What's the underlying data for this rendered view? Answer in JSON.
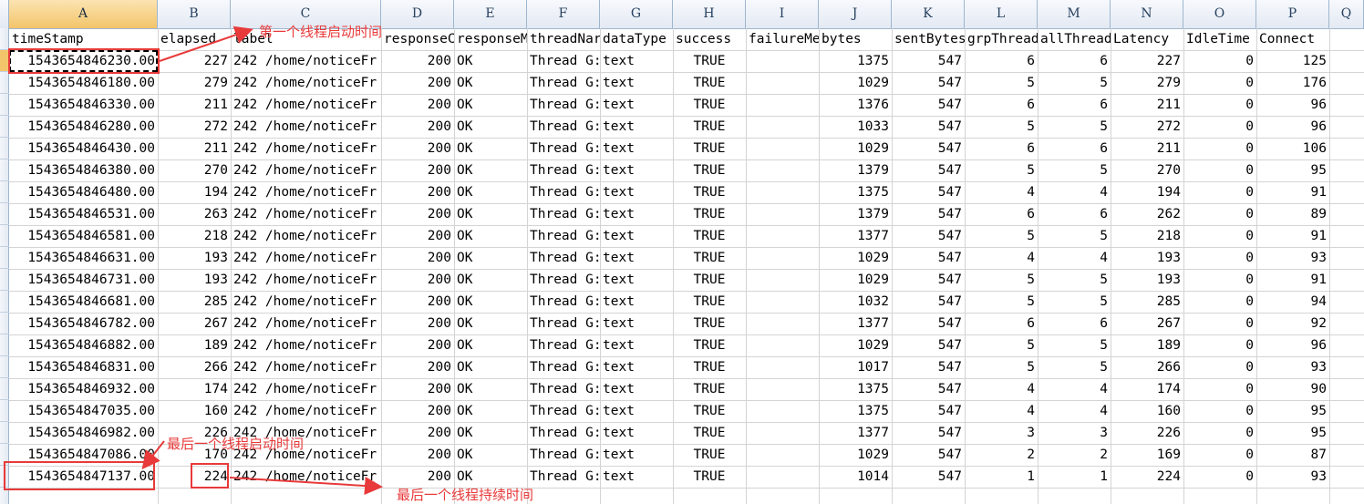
{
  "columns": [
    "A",
    "B",
    "C",
    "D",
    "E",
    "F",
    "G",
    "H",
    "I",
    "J",
    "K",
    "L",
    "M",
    "N",
    "O",
    "P",
    "Q"
  ],
  "headers": [
    "timeStamp",
    "elapsed",
    "label",
    "responseC",
    "responseM",
    "threadNar",
    "dataType",
    "success",
    "failureMe",
    "bytes",
    "sentBytes",
    "grpThread",
    "allThread",
    "Latency",
    "IdleTime",
    "Connect",
    ""
  ],
  "rows": [
    [
      "1543654846230.00",
      "227",
      "242 /home/noticeFr",
      "200",
      "OK",
      "Thread G:",
      "text",
      "TRUE",
      "",
      "1375",
      "547",
      "6",
      "6",
      "227",
      "0",
      "125"
    ],
    [
      "1543654846180.00",
      "279",
      "242 /home/noticeFr",
      "200",
      "OK",
      "Thread G:",
      "text",
      "TRUE",
      "",
      "1029",
      "547",
      "5",
      "5",
      "279",
      "0",
      "176"
    ],
    [
      "1543654846330.00",
      "211",
      "242 /home/noticeFr",
      "200",
      "OK",
      "Thread G:",
      "text",
      "TRUE",
      "",
      "1376",
      "547",
      "6",
      "6",
      "211",
      "0",
      "96"
    ],
    [
      "1543654846280.00",
      "272",
      "242 /home/noticeFr",
      "200",
      "OK",
      "Thread G:",
      "text",
      "TRUE",
      "",
      "1033",
      "547",
      "5",
      "5",
      "272",
      "0",
      "96"
    ],
    [
      "1543654846430.00",
      "211",
      "242 /home/noticeFr",
      "200",
      "OK",
      "Thread G:",
      "text",
      "TRUE",
      "",
      "1029",
      "547",
      "6",
      "6",
      "211",
      "0",
      "106"
    ],
    [
      "1543654846380.00",
      "270",
      "242 /home/noticeFr",
      "200",
      "OK",
      "Thread G:",
      "text",
      "TRUE",
      "",
      "1379",
      "547",
      "5",
      "5",
      "270",
      "0",
      "95"
    ],
    [
      "1543654846480.00",
      "194",
      "242 /home/noticeFr",
      "200",
      "OK",
      "Thread G:",
      "text",
      "TRUE",
      "",
      "1375",
      "547",
      "4",
      "4",
      "194",
      "0",
      "91"
    ],
    [
      "1543654846531.00",
      "263",
      "242 /home/noticeFr",
      "200",
      "OK",
      "Thread G:",
      "text",
      "TRUE",
      "",
      "1379",
      "547",
      "6",
      "6",
      "262",
      "0",
      "89"
    ],
    [
      "1543654846581.00",
      "218",
      "242 /home/noticeFr",
      "200",
      "OK",
      "Thread G:",
      "text",
      "TRUE",
      "",
      "1377",
      "547",
      "5",
      "5",
      "218",
      "0",
      "91"
    ],
    [
      "1543654846631.00",
      "193",
      "242 /home/noticeFr",
      "200",
      "OK",
      "Thread G:",
      "text",
      "TRUE",
      "",
      "1029",
      "547",
      "4",
      "4",
      "193",
      "0",
      "93"
    ],
    [
      "1543654846731.00",
      "193",
      "242 /home/noticeFr",
      "200",
      "OK",
      "Thread G:",
      "text",
      "TRUE",
      "",
      "1029",
      "547",
      "5",
      "5",
      "193",
      "0",
      "91"
    ],
    [
      "1543654846681.00",
      "285",
      "242 /home/noticeFr",
      "200",
      "OK",
      "Thread G:",
      "text",
      "TRUE",
      "",
      "1032",
      "547",
      "5",
      "5",
      "285",
      "0",
      "94"
    ],
    [
      "1543654846782.00",
      "267",
      "242 /home/noticeFr",
      "200",
      "OK",
      "Thread G:",
      "text",
      "TRUE",
      "",
      "1377",
      "547",
      "6",
      "6",
      "267",
      "0",
      "92"
    ],
    [
      "1543654846882.00",
      "189",
      "242 /home/noticeFr",
      "200",
      "OK",
      "Thread G:",
      "text",
      "TRUE",
      "",
      "1029",
      "547",
      "5",
      "5",
      "189",
      "0",
      "96"
    ],
    [
      "1543654846831.00",
      "266",
      "242 /home/noticeFr",
      "200",
      "OK",
      "Thread G:",
      "text",
      "TRUE",
      "",
      "1017",
      "547",
      "5",
      "5",
      "266",
      "0",
      "93"
    ],
    [
      "1543654846932.00",
      "174",
      "242 /home/noticeFr",
      "200",
      "OK",
      "Thread G:",
      "text",
      "TRUE",
      "",
      "1375",
      "547",
      "4",
      "4",
      "174",
      "0",
      "90"
    ],
    [
      "1543654847035.00",
      "160",
      "242 /home/noticeFr",
      "200",
      "OK",
      "Thread G:",
      "text",
      "TRUE",
      "",
      "1375",
      "547",
      "4",
      "4",
      "160",
      "0",
      "95"
    ],
    [
      "1543654846982.00",
      "226",
      "242 /home/noticeFr",
      "200",
      "OK",
      "Thread G:",
      "text",
      "TRUE",
      "",
      "1377",
      "547",
      "3",
      "3",
      "226",
      "0",
      "95"
    ],
    [
      "1543654847086.00",
      "170",
      "242 /home/noticeFr",
      "200",
      "OK",
      "Thread G:",
      "text",
      "TRUE",
      "",
      "1029",
      "547",
      "2",
      "2",
      "169",
      "0",
      "87"
    ],
    [
      "1543654847137.00",
      "224",
      "242 /home/noticeFr",
      "200",
      "OK",
      "Thread G:",
      "text",
      "TRUE",
      "",
      "1014",
      "547",
      "1",
      "1",
      "224",
      "0",
      "93"
    ]
  ],
  "annotations": {
    "first_thread_start": "第一个线程启动时间",
    "last_thread_start": "最后一个线程启动时间",
    "last_thread_duration": "最后一个线程持续时间"
  },
  "colors": {
    "annotation": "#e83a3a",
    "header_bg": "#e3e9f3",
    "selected_header": "#f3c56a",
    "gridline": "#d4d4d4"
  }
}
